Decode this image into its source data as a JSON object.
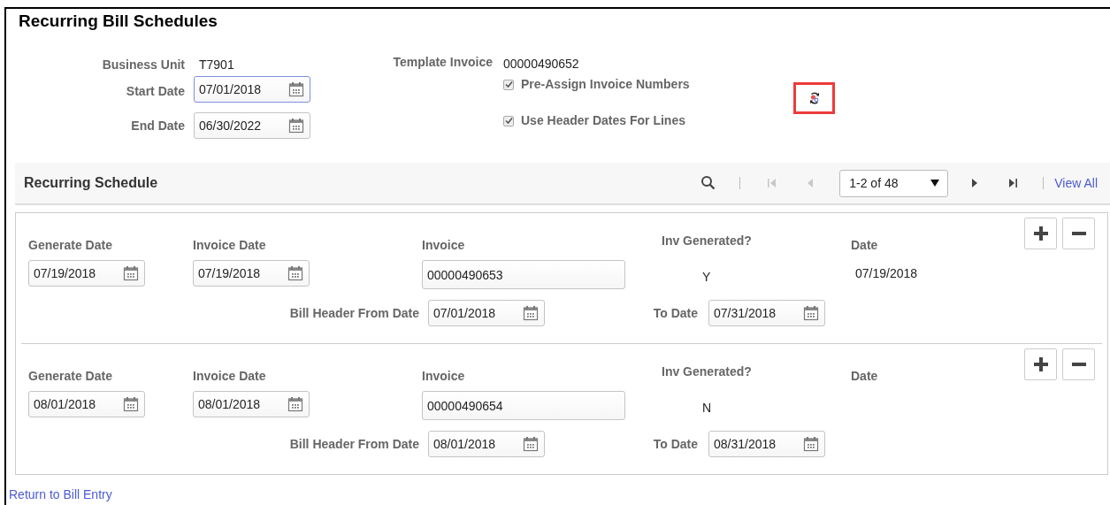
{
  "title": "Recurring Bill Schedules",
  "header": {
    "business_unit": {
      "label": "Business Unit",
      "value": "T7901"
    },
    "start_date": {
      "label": "Start Date",
      "value": "07/01/2018",
      "focused": true
    },
    "end_date": {
      "label": "End Date",
      "value": "06/30/2022",
      "focused": false
    },
    "template_invoice": {
      "label": "Template Invoice",
      "value": "00000490652"
    },
    "checkboxes": [
      {
        "label": "Pre-Assign Invoice Numbers",
        "checked": true
      },
      {
        "label": "Use Header Dates For Lines",
        "checked": true
      }
    ]
  },
  "grid": {
    "title": "Recurring Schedule",
    "pager": {
      "range": "1-2 of 48",
      "prev_enabled": false,
      "next_enabled": true
    },
    "view_all": "View All",
    "rows": [
      {
        "generate_date": {
          "label": "Generate Date",
          "value": "07/19/2018"
        },
        "invoice_date": {
          "label": "Invoice Date",
          "value": "07/19/2018"
        },
        "invoice": {
          "label": "Invoice",
          "value": "00000490653"
        },
        "inv_generated": {
          "label": "Inv Generated?",
          "value": "Y"
        },
        "date": {
          "label": "Date",
          "value": "07/19/2018"
        },
        "bill_header_from_date": {
          "label": "Bill Header From Date",
          "value": "07/01/2018"
        },
        "to_date": {
          "label": "To Date",
          "value": "07/31/2018"
        }
      },
      {
        "generate_date": {
          "label": "Generate Date",
          "value": "08/01/2018"
        },
        "invoice_date": {
          "label": "Invoice Date",
          "value": "08/01/2018"
        },
        "invoice": {
          "label": "Invoice",
          "value": "00000490654"
        },
        "inv_generated": {
          "label": "Inv Generated?",
          "value": "N"
        },
        "date": {
          "label": "Date"
        },
        "bill_header_from_date": {
          "label": "Bill Header From Date",
          "value": "08/01/2018"
        },
        "to_date": {
          "label": "To Date",
          "value": "08/31/2018"
        }
      }
    ]
  },
  "return_link": "Return to Bill Entry"
}
